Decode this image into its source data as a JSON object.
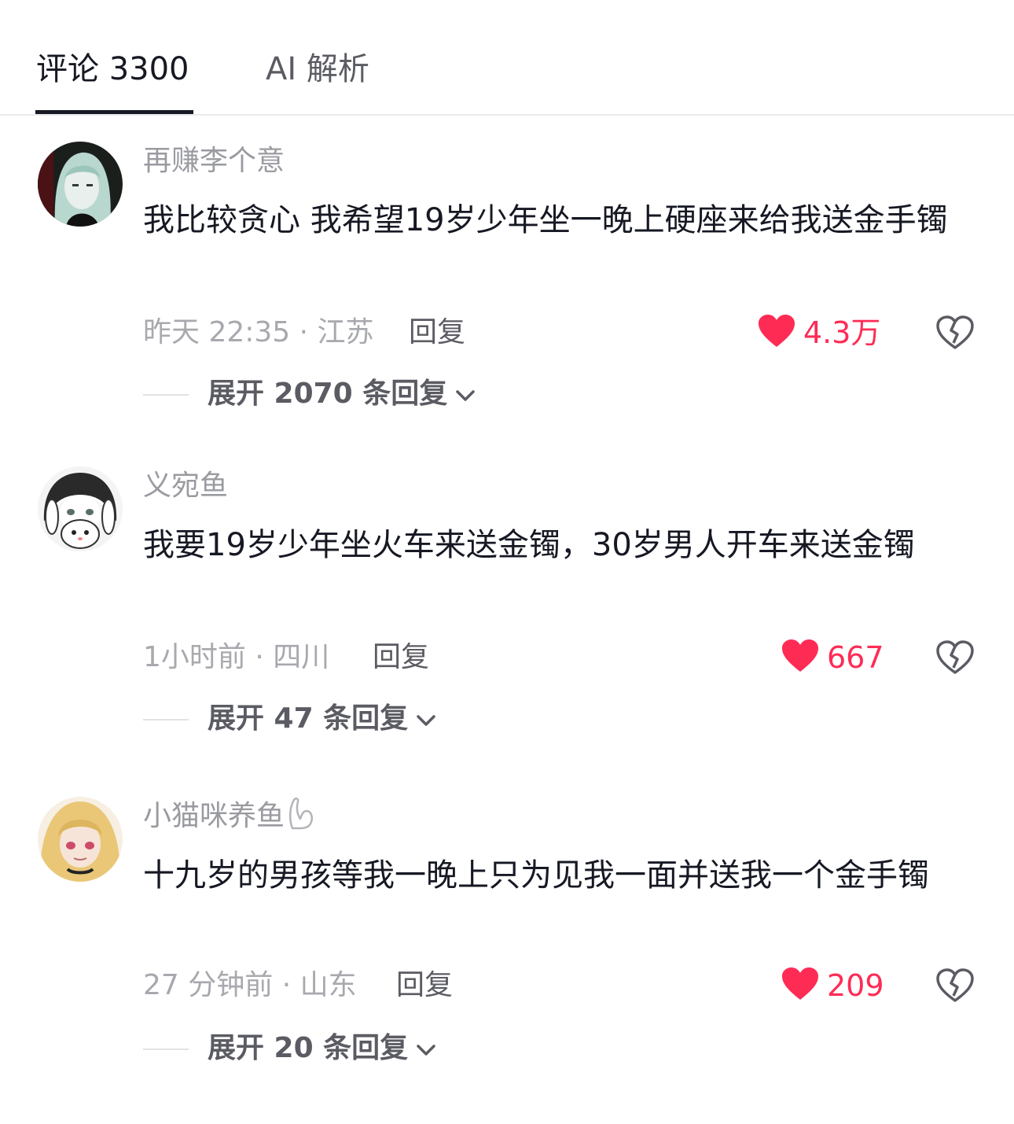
{
  "tabs": {
    "comments_label": "评论 3300",
    "ai_label": "AI 解析"
  },
  "comments": [
    {
      "username": "再赚李个意",
      "text": "我比较贪心 我希望19岁少年坐一晚上硬座来给我送金手镯",
      "meta": "昨天 22:35 · 江苏",
      "reply_label": "回复",
      "likes": "4.3万",
      "expand_label": "展开 2070 条回复"
    },
    {
      "username": "义宛鱼",
      "text": "我要19岁少年坐火车来送金镯，30岁男人开车来送金镯",
      "meta": "1小时前 · 四川",
      "reply_label": "回复",
      "likes": "667",
      "expand_label": "展开 47 条回复"
    },
    {
      "username": "小猫咪养鱼",
      "text": "十九岁的男孩等我一晚上只为见我一面并送我一个金手镯",
      "meta": "27 分钟前 · 山东",
      "reply_label": "回复",
      "likes": "209",
      "expand_label": "展开 20 条回复"
    }
  ],
  "colors": {
    "accent": "#fe2c55",
    "text_primary": "#161823",
    "text_secondary": "#9a9ba1"
  },
  "icons": {
    "like": "heart-icon",
    "dislike": "broken-heart-icon",
    "expand": "chevron-down-icon"
  }
}
